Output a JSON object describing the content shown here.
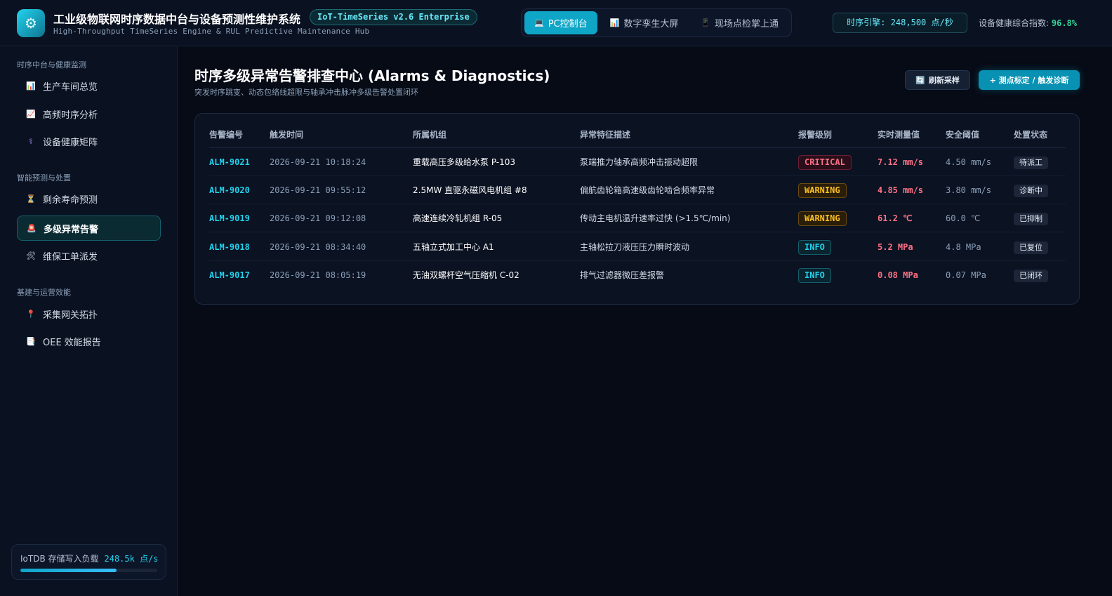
{
  "header": {
    "logo_icon": "gear-icon",
    "title": "工业级物联网时序数据中台与设备预测性维护系统",
    "subtitle": "High-Throughput TimeSeries Engine & RUL Predictive Maintenance Hub",
    "version": "IoT-TimeSeries v2.6 Enterprise",
    "views": [
      {
        "label": "PC控制台",
        "icon": "laptop-icon",
        "active": true
      },
      {
        "label": "数字孪生大屏",
        "icon": "chart-icon",
        "active": false
      },
      {
        "label": "现场点检掌上通",
        "icon": "phone-icon",
        "active": false
      }
    ],
    "engine_rate": "时序引擎: 248,500 点/秒",
    "health_label": "设备健康综合指数:",
    "health_value": "96.8%"
  },
  "sidebar": {
    "sections": [
      {
        "title": "时序中台与健康监测",
        "items": [
          {
            "label": "生产车间总览",
            "icon": "bar-chart-icon"
          },
          {
            "label": "高频时序分析",
            "icon": "line-chart-icon"
          },
          {
            "label": "设备健康矩阵",
            "icon": "stethoscope-icon"
          }
        ]
      },
      {
        "title": "智能预测与处置",
        "items": [
          {
            "label": "剩余寿命预测",
            "icon": "hourglass-icon"
          },
          {
            "label": "多级异常告警",
            "icon": "siren-icon",
            "active": true
          },
          {
            "label": "维保工单派发",
            "icon": "tools-icon"
          }
        ]
      },
      {
        "title": "基建与运营效能",
        "items": [
          {
            "label": "采集网关拓扑",
            "icon": "probe-icon"
          },
          {
            "label": "OEE 效能报告",
            "icon": "report-icon"
          }
        ]
      }
    ],
    "storage": {
      "label": "IoTDB 存储写入负载",
      "value": "248.5k 点/s",
      "fill_fraction": 0.7
    }
  },
  "main": {
    "title": "时序多级异常告警排查中心 (Alarms & Diagnostics)",
    "subtitle": "突发时序跳变、动态包络线超限与轴承冲击脉冲多级告警处置闭环",
    "refresh_label": "刷新采样",
    "primary_label": "+ 测点标定 / 触发诊断",
    "table": {
      "headers": [
        "告警编号",
        "触发时间",
        "所属机组",
        "异常特征描述",
        "报警级别",
        "实时测量值",
        "安全阈值",
        "处置状态"
      ],
      "rows": [
        {
          "id": "ALM-9021",
          "time": "2026-09-21 10:18:24",
          "machine": "重载高压多级给水泵 P-103",
          "desc": "泵端推力轴承高频冲击振动超限",
          "level": "CRITICAL",
          "level_class": "critical",
          "measured": "7.12 mm/s",
          "threshold": "4.50 mm/s",
          "status": "待派工"
        },
        {
          "id": "ALM-9020",
          "time": "2026-09-21 09:55:12",
          "machine": "2.5MW 直驱永磁风电机组 #8",
          "desc": "偏航齿轮箱高速级齿轮啮合频率异常",
          "level": "WARNING",
          "level_class": "warning",
          "measured": "4.85 mm/s",
          "threshold": "3.80 mm/s",
          "status": "诊断中"
        },
        {
          "id": "ALM-9019",
          "time": "2026-09-21 09:12:08",
          "machine": "高速连续冷轧机组 R-05",
          "desc": "传动主电机温升速率过快 (>1.5℃/min)",
          "level": "WARNING",
          "level_class": "warning",
          "measured": "61.2 ℃",
          "threshold": "60.0 ℃",
          "status": "已抑制"
        },
        {
          "id": "ALM-9018",
          "time": "2026-09-21 08:34:40",
          "machine": "五轴立式加工中心 A1",
          "desc": "主轴松拉刀液压压力瞬时波动",
          "level": "INFO",
          "level_class": "info",
          "measured": "5.2 MPa",
          "threshold": "4.8 MPa",
          "status": "已复位"
        },
        {
          "id": "ALM-9017",
          "time": "2026-09-21 08:05:19",
          "machine": "无油双螺杆空气压缩机 C-02",
          "desc": "排气过滤器微压差报警",
          "level": "INFO",
          "level_class": "info",
          "measured": "0.08 MPa",
          "threshold": "0.07 MPa",
          "status": "已闭环"
        }
      ]
    }
  }
}
